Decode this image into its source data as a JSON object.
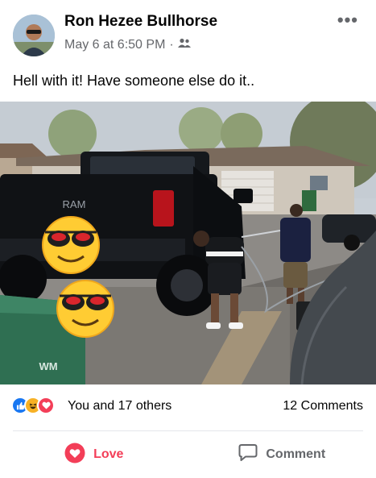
{
  "post": {
    "author": "Ron Hezee Bullhorse",
    "timestamp": "May 6 at 6:50 PM",
    "separator": "·",
    "audience_icon": "friends-icon",
    "more_icon": "more-options-icon",
    "more_label": "•••",
    "caption": "Hell with it! Have someone else do it..",
    "photo": {
      "truck_logo": "RAM",
      "dumpster_label": "WM"
    }
  },
  "reactions": {
    "icons": [
      "like-icon",
      "haha-icon",
      "love-icon"
    ],
    "count_text": "You and 17 others",
    "comments_text": "12 Comments"
  },
  "actions": {
    "love_label": "Love",
    "comment_label": "Comment"
  },
  "colors": {
    "love_red": "#f33e58",
    "like_blue": "#1877f2",
    "haha_yellow": "#f7b125",
    "secondary_text": "#65676b"
  }
}
